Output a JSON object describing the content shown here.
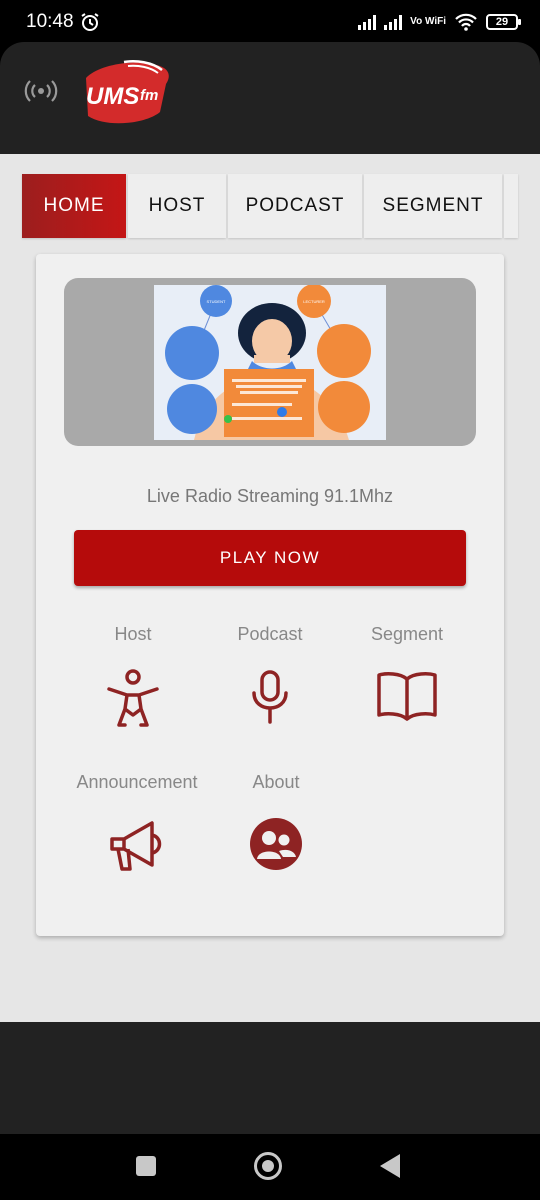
{
  "status_bar": {
    "time": "10:48",
    "network": "Vo WiFi",
    "battery": "29"
  },
  "header": {
    "logo_text": "UMS fm"
  },
  "tabs": [
    {
      "label": "HOME",
      "active": true
    },
    {
      "label": "HOST",
      "active": false
    },
    {
      "label": "PODCAST",
      "active": false
    },
    {
      "label": "SEGMENT",
      "active": false
    }
  ],
  "main": {
    "stream_text": "Live Radio Streaming 91.1Mhz",
    "play_label": "PLAY NOW",
    "menu": [
      {
        "label": "Host",
        "icon": "accessibility-icon"
      },
      {
        "label": "Podcast",
        "icon": "microphone-icon"
      },
      {
        "label": "Segment",
        "icon": "book-open-icon"
      },
      {
        "label": "Announcement",
        "icon": "megaphone-icon"
      },
      {
        "label": "About",
        "icon": "group-icon"
      }
    ]
  },
  "banner": {
    "bubble_left": "STUDENT",
    "bubble_right": "LECTURER"
  },
  "colors": {
    "accent": "#b50b0b",
    "icon": "#8e2323",
    "header_bg": "#222222"
  }
}
